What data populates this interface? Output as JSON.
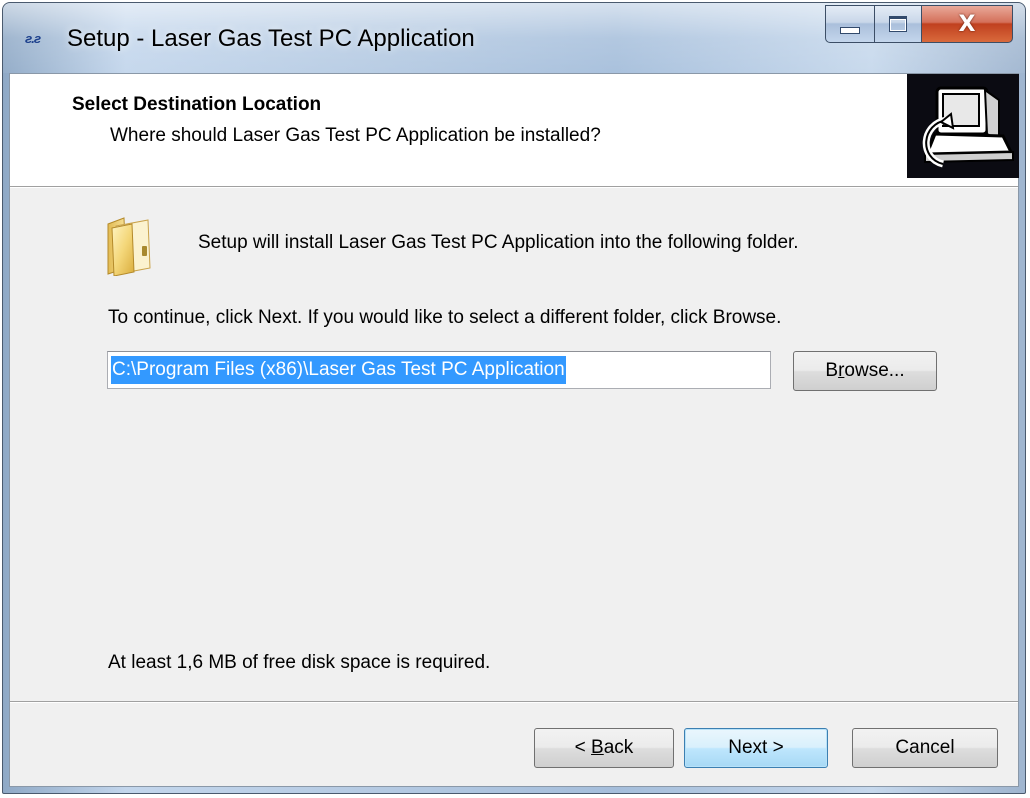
{
  "window": {
    "title": "Setup - Laser Gas Test PC Application",
    "app_icon_text": "ƨ.ƨ",
    "close_glyph": "X"
  },
  "header": {
    "title": "Select Destination Location",
    "subtitle": "Where should Laser Gas Test PC Application be installed?"
  },
  "body": {
    "install_line": "Setup will install Laser Gas Test PC Application into the following folder.",
    "continue_line": "To continue, click Next. If you would like to select a different folder, click Browse.",
    "path_value": "C:\\Program Files (x86)\\Laser Gas Test PC Application",
    "browse_pre": "B",
    "browse_hot": "r",
    "browse_post": "owse...",
    "disk_space": "At least 1,6 MB of free disk space is required."
  },
  "buttons": {
    "back_pre": "< ",
    "back_hot": "B",
    "back_post": "ack",
    "next_label": "Next >",
    "cancel_label": "Cancel"
  },
  "icons": {
    "title_icon": "app-logo-icon",
    "header_icon": "computer-install-icon",
    "folder_icon": "folder-icon",
    "minimize": "minimize-icon",
    "maximize": "maximize-icon",
    "close": "close-icon"
  },
  "colors": {
    "selection": "#3399ff",
    "close_button": "#c0401f",
    "default_button_border": "#3c7fb1"
  }
}
